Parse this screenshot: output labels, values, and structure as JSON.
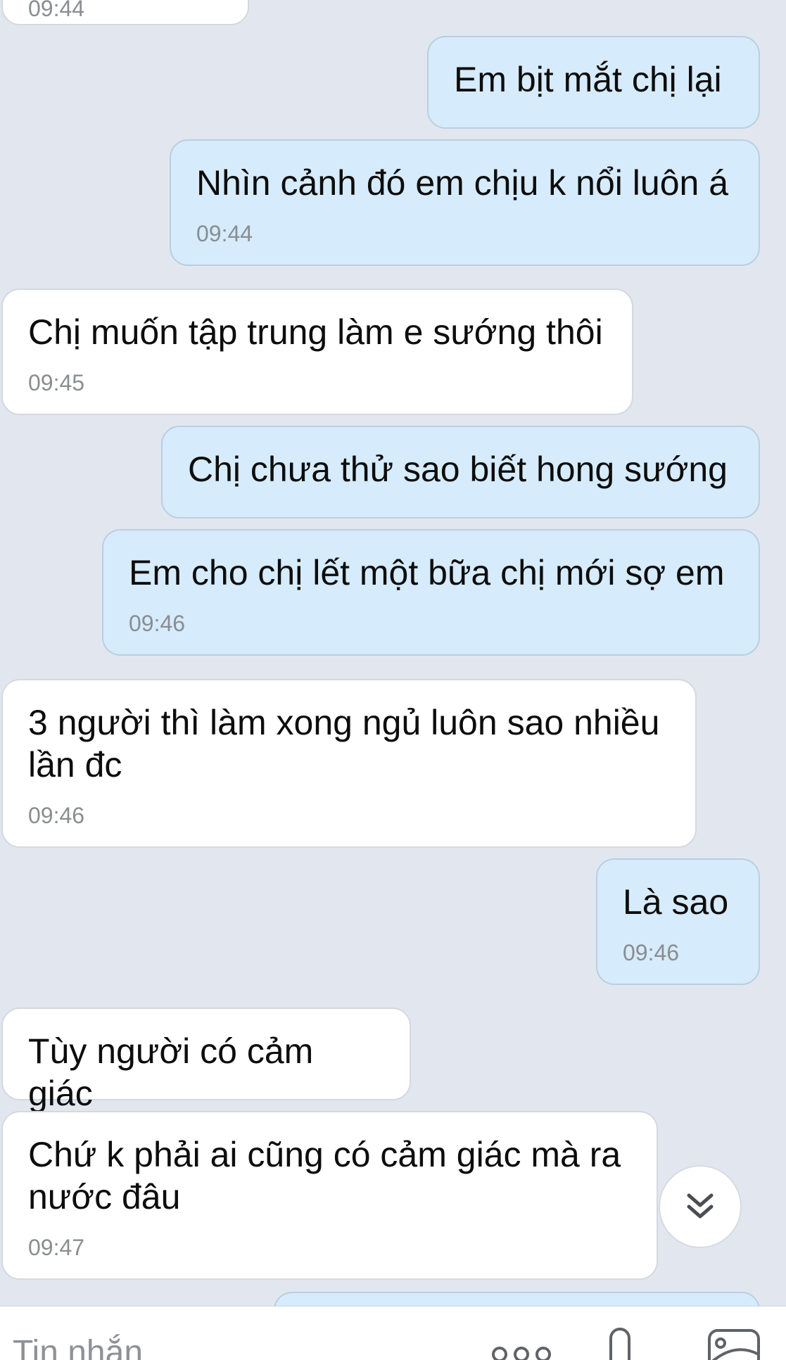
{
  "messages": [
    {
      "side": "recv",
      "text": "",
      "time": "09:44"
    },
    {
      "side": "sent",
      "text": "Em bịt mắt chị lại",
      "time": ""
    },
    {
      "side": "sent",
      "text": "Nhìn cảnh đó em chịu k nổi luôn á",
      "time": "09:44"
    },
    {
      "side": "recv",
      "text": "Chị muốn tập trung làm e sướng thôi",
      "time": "09:45"
    },
    {
      "side": "sent",
      "text": "Chị chưa thử sao biết hong sướng",
      "time": ""
    },
    {
      "side": "sent",
      "text": "Em cho chị lết một bữa chị mới sợ em",
      "time": "09:46"
    },
    {
      "side": "recv",
      "text": "3 người thì làm xong ngủ luôn sao nhiều\nlần đc",
      "time": "09:46"
    },
    {
      "side": "sent",
      "text": "Là sao",
      "time": "09:46"
    },
    {
      "side": "recv",
      "text": "Tùy người có cảm giác",
      "time": ""
    },
    {
      "side": "recv",
      "text": "Chứ k phải ai cũng có cảm giác mà ra\nnước đâu",
      "time": "09:47"
    },
    {
      "side": "sent",
      "text": "",
      "time": ""
    }
  ],
  "input": {
    "placeholder": "Tin nhắn"
  },
  "icons": {
    "scroll_down": "double-chevron-down-icon",
    "sticker": "sticker-icon",
    "mic": "microphone-icon",
    "image": "image-icon"
  },
  "colors": {
    "background": "#e2e7ef",
    "sent_bubble": "#d6ebfb",
    "received_bubble": "#ffffff",
    "timestamp": "#8a8d91"
  }
}
